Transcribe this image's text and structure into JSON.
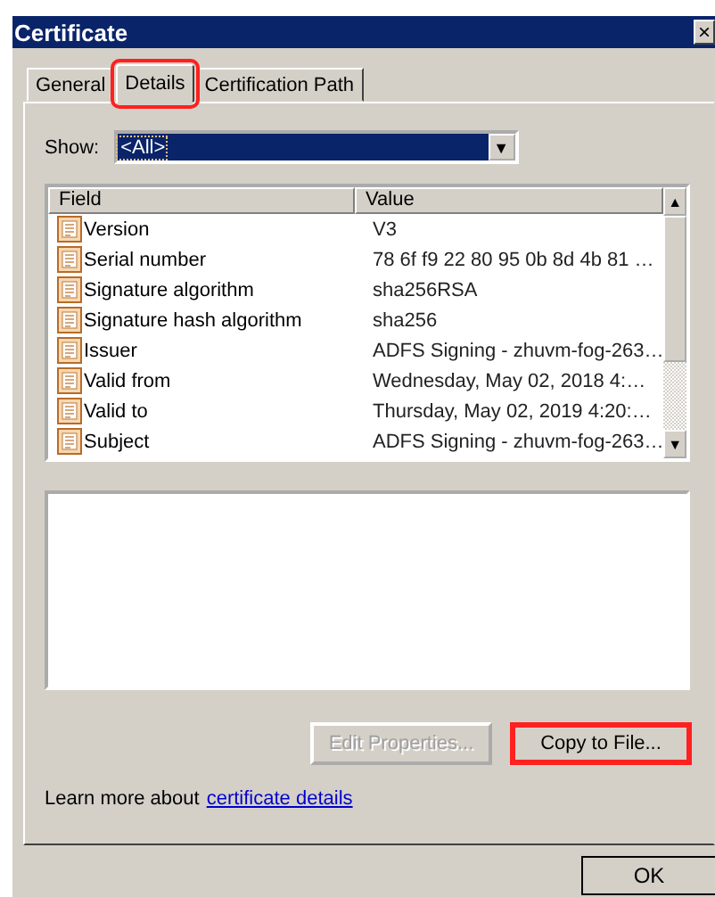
{
  "window": {
    "title": "Certificate",
    "close": "×"
  },
  "tabs": [
    {
      "label": "General",
      "selected": false,
      "highlighted": false
    },
    {
      "label": "Details",
      "selected": true,
      "highlighted": true
    },
    {
      "label": "Certification Path",
      "selected": false,
      "highlighted": false
    }
  ],
  "show": {
    "label": "Show:",
    "value": "<All>",
    "arrow": "▼"
  },
  "table": {
    "columns": [
      "Field",
      "Value"
    ],
    "rows": [
      {
        "field": "Version",
        "value": "V3"
      },
      {
        "field": "Serial number",
        "value": "78 6f f9 22 80 95 0b 8d 4b 81 …"
      },
      {
        "field": "Signature algorithm",
        "value": "sha256RSA"
      },
      {
        "field": "Signature hash algorithm",
        "value": "sha256"
      },
      {
        "field": "Issuer",
        "value": "ADFS Signing - zhuvm-fog-263…"
      },
      {
        "field": "Valid from",
        "value": "Wednesday, May 02, 2018 4:…"
      },
      {
        "field": "Valid to",
        "value": "Thursday, May 02, 2019 4:20:…"
      },
      {
        "field": "Subject",
        "value": "ADFS Signing - zhuvm-fog-263…"
      }
    ],
    "scroll_up": "▲",
    "scroll_down": "▼"
  },
  "buttons": [
    {
      "label": "Edit Properties...",
      "disabled": true,
      "highlighted": false
    },
    {
      "label": "Copy to File...",
      "disabled": false,
      "highlighted": true
    }
  ],
  "learn_more": {
    "text": "Learn more about",
    "link": "certificate details"
  },
  "ok_button": "OK"
}
